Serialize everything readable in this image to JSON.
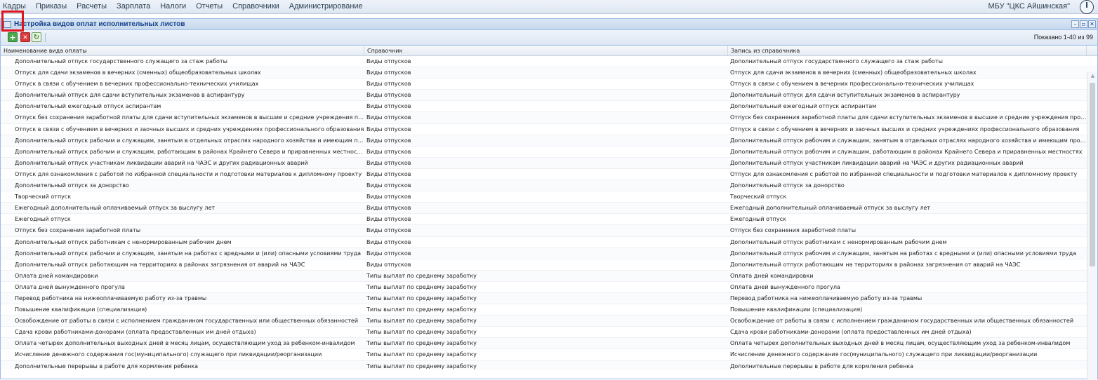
{
  "menu": [
    "Кадры",
    "Приказы",
    "Расчеты",
    "Зарплата",
    "Налоги",
    "Отчеты",
    "Справочники",
    "Администрирование"
  ],
  "org": "МБУ \"ЦКС Айшинская\"",
  "window": {
    "title": "Настройка видов оплат исполнительных листов",
    "shown": "Показано 1-40 из 99"
  },
  "columns": [
    "Наименование вида оплаты",
    "Справочник",
    "Запись из справочника"
  ],
  "rows": [
    [
      "Дополнительный отпуск государственного служащего за стаж работы",
      "Виды отпусков",
      "Дополнительный отпуск государственного служащего за стаж работы"
    ],
    [
      "Отпуск для сдачи экзаменов в вечерних (сменных) общеобразовательных школах",
      "Виды отпусков",
      "Отпуск для сдачи экзаменов в вечерних (сменных) общеобразовательных школах"
    ],
    [
      "Отпуск в связи с обучением в вечерних профессионально-технических училищах",
      "Виды отпусков",
      "Отпуск в связи с обучением в вечерних профессионально-технических училищах"
    ],
    [
      "Дополнительный отпуск для сдачи вступительных экзаменов в аспирантуру",
      "Виды отпусков",
      "Дополнительный отпуск для сдачи вступительных экзаменов в аспирантуру"
    ],
    [
      "Дополнительный ежегодный отпуск аспирантам",
      "Виды отпусков",
      "Дополнительный ежегодный отпуск аспирантам"
    ],
    [
      "Отпуск без сохранения заработной платы для сдачи вступительных экзаменов в высшие и средние учреждения про...",
      "Виды отпусков",
      "Отпуск без сохранения заработной платы для сдачи вступительных экзаменов в высшие и средние учреждения профес..."
    ],
    [
      "Отпуск в связи с обучением в вечерних и заочных высших и средних учреждениях профессионального образования",
      "Виды отпусков",
      "Отпуск в связи с обучением в вечерних и заочных высших и средних учреждениях профессионального образования"
    ],
    [
      "Дополнительный отпуск рабочим и служащим, занятым в отдельных отраслях народного хозяйства и имеющим прод...",
      "Виды отпусков",
      "Дополнительный отпуск рабочим и служащим, занятым в отдельных отраслях народного хозяйства и имеющим продол..."
    ],
    [
      "Дополнительный отпуск рабочим и служащим, работающим в районах Крайнего Севера и приравненных местностях",
      "Виды отпусков",
      "Дополнительный отпуск рабочим и служащим, работающим в районах Крайнего Севера и приравненных местностях"
    ],
    [
      "Дополнительный отпуск участникам ликвидации аварий на ЧАЭС и других радиационных аварий",
      "Виды отпусков",
      "Дополнительный отпуск участникам ликвидации аварий на ЧАЭС и других радиационных аварий"
    ],
    [
      "Отпуск для ознакомления с работой по избранной специальности и подготовки материалов к дипломному проекту",
      "Виды отпусков",
      "Отпуск для ознакомления с работой по избранной специальности и подготовки материалов к дипломному проекту"
    ],
    [
      "Дополнительный отпуск за донорство",
      "Виды отпусков",
      "Дополнительный отпуск за донорство"
    ],
    [
      "Творческий отпуск",
      "Виды отпусков",
      "Творческий отпуск"
    ],
    [
      "Ежегодный дополнительный оплачиваемый отпуск за выслугу лет",
      "Виды отпусков",
      "Ежегодный дополнительный оплачиваемый отпуск за выслугу лет"
    ],
    [
      "Ежегодный отпуск",
      "Виды отпусков",
      "Ежегодный отпуск"
    ],
    [
      "Отпуск без сохранения заработной платы",
      "Виды отпусков",
      "Отпуск без сохранения заработной платы"
    ],
    [
      "Дополнительный отпуск работникам с ненормированным рабочим днем",
      "Виды отпусков",
      "Дополнительный отпуск работникам с ненормированным рабочим днем"
    ],
    [
      "Дополнительный отпуск рабочим и служащим, занятым на работах с вредными и (или) опасными условиями труда",
      "Виды отпусков",
      "Дополнительный отпуск рабочим и служащим, занятым на работах с вредными и (или) опасными условиями труда"
    ],
    [
      "Дополнительный отпуск работающим на территориях в районах загрязнения от аварий на ЧАЭС",
      "Виды отпусков",
      "Дополнительный отпуск работающим на территориях в районах загрязнения от аварий на ЧАЭС"
    ],
    [
      "Оплата дней командировки",
      "Типы выплат по среднему заработку",
      "Оплата дней командировки"
    ],
    [
      "Оплата дней вынужденного прогула",
      "Типы выплат по среднему заработку",
      "Оплата дней вынужденного прогула"
    ],
    [
      "Перевод работника на нижеоплачиваемую работу из-за травмы",
      "Типы выплат по среднему заработку",
      "Перевод работника на нижеоплачиваемую работу из-за травмы"
    ],
    [
      "Повышение квалификации (специализация)",
      "Типы выплат по среднему заработку",
      "Повышение квалификации (специализация)"
    ],
    [
      "Освобождение от работы в связи с исполнением гражданином государственных или общественных обязанностей",
      "Типы выплат по среднему заработку",
      "Освобождение от работы в связи с исполнением гражданином государственных или общественных обязанностей"
    ],
    [
      "Сдача крови работниками-донорами (оплата предоставленных им дней отдыха)",
      "Типы выплат по среднему заработку",
      "Сдача крови работниками-донорами (оплата предоставленных им дней отдыха)"
    ],
    [
      "Оплата четырех дополнительных выходных дней в месяц лицам, осуществляющим уход за ребенком-инвалидом",
      "Типы выплат по среднему заработку",
      "Оплата четырех дополнительных выходных дней в месяц лицам, осуществляющим уход за ребенком-инвалидом"
    ],
    [
      "Исчисление денежного содержания гос(муниципального) служащего при ликвидации/реорганизации",
      "Типы выплат по среднему заработку",
      "Исчисление денежного содержания гос(муниципального) служащего при ликвидации/реорганизации"
    ],
    [
      "Дополнительные перерывы в работе для кормления ребенка",
      "Типы выплат по среднему заработку",
      "Дополнительные перерывы в работе для кормления ребенка"
    ]
  ]
}
